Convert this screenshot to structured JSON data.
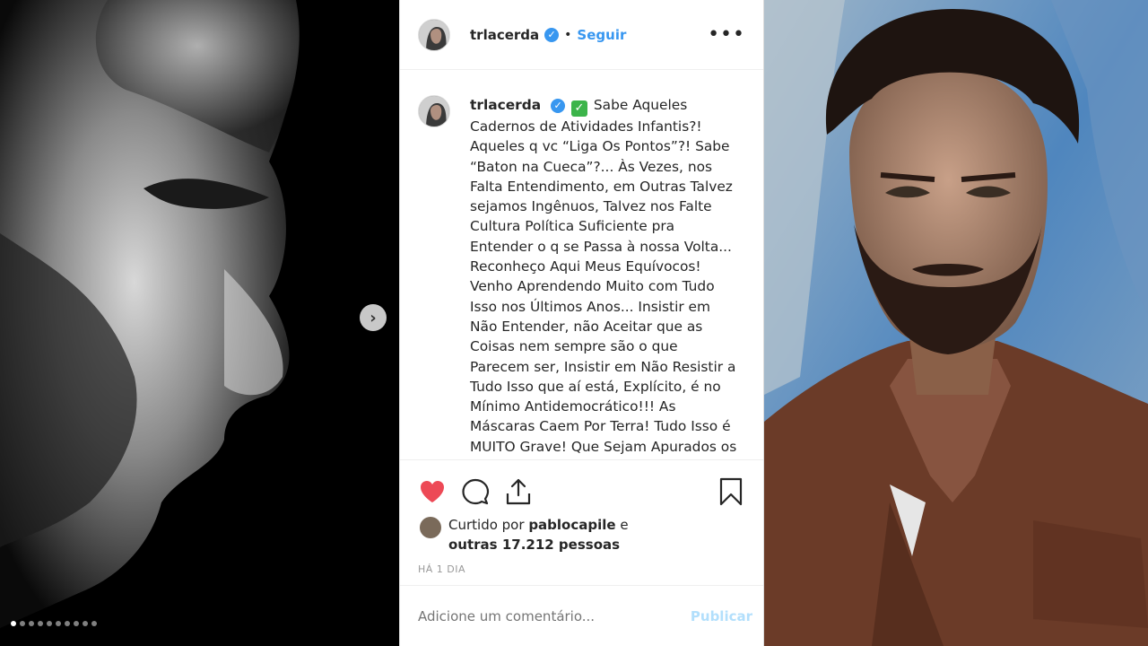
{
  "post": {
    "username": "trlacerda",
    "separator": "•",
    "follow_label": "Seguir",
    "more_label": "•••",
    "caption_username": "trlacerda",
    "caption_lines": [
      "Sabe Aqueles",
      "Cadernos de Atividades Infantis?!",
      "Aqueles q vc “Liga Os Pontos”?! Sabe",
      "“Baton na Cueca”?... Às Vezes, nos",
      "Falta Entendimento, em Outras Talvez",
      "sejamos Ingênuos, Talvez nos Falte",
      "Cultura Política Suficiente pra",
      "Entender o q se Passa à nossa Volta...",
      "Reconheço Aqui Meus Equívocos!",
      "Venho Aprendendo Muito com Tudo",
      "Isso nos Últimos Anos... Insistir em",
      "Não Entender, não Aceitar que as",
      "Coisas nem sempre são o que",
      "Parecem ser, Insistir em Não Resistir a",
      "Tudo Isso que aí está, Explícito, é no",
      "Mínimo Antidemocrático!!! As",
      "Máscaras Caem Por Terra! Tudo Isso é",
      "MUITO Grave! Que Sejam Apurados os"
    ],
    "likes_prefix": "Curtido por",
    "likes_user": "pablocapile",
    "likes_conj": "e",
    "likes_others": "outras 17.212 pessoas",
    "time": "HÁ 1 DIA",
    "comment_placeholder": "Adicione um comentário...",
    "publish_label": "Publicar"
  },
  "carousel": {
    "next_arrow": "›",
    "dot_count": 10,
    "active_index": 0
  },
  "colors": {
    "accent": "#3897f0",
    "heart": "#ed4956",
    "publish_disabled": "#b2dffc"
  }
}
